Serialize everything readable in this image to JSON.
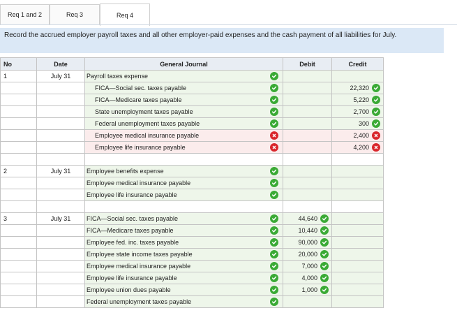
{
  "tabs": [
    {
      "label": "Req 1 and 2"
    },
    {
      "label": "Req 3"
    },
    {
      "label": "Req 4"
    }
  ],
  "instructions": "Record the accrued employer payroll taxes and all other employer-paid expenses and the cash payment of all liabilities for July.",
  "table": {
    "headers": {
      "no": "No",
      "date": "Date",
      "account": "General Journal",
      "debit": "Debit",
      "credit": "Credit"
    },
    "rows": [
      {
        "no": "1",
        "date": "July 31",
        "account": "Payroll taxes expense",
        "indent": false,
        "debit": "",
        "credit": "",
        "status": "ok",
        "debit_status": "",
        "credit_status": ""
      },
      {
        "no": "",
        "date": "",
        "account": "FICA—Social sec. taxes payable",
        "indent": true,
        "debit": "",
        "credit": "22,320",
        "status": "ok",
        "debit_status": "",
        "credit_status": "ok"
      },
      {
        "no": "",
        "date": "",
        "account": "FICA—Medicare taxes payable",
        "indent": true,
        "debit": "",
        "credit": "5,220",
        "status": "ok",
        "debit_status": "",
        "credit_status": "ok"
      },
      {
        "no": "",
        "date": "",
        "account": "State unemployment taxes payable",
        "indent": true,
        "debit": "",
        "credit": "2,700",
        "status": "ok",
        "debit_status": "",
        "credit_status": "ok"
      },
      {
        "no": "",
        "date": "",
        "account": "Federal unemployment taxes payable",
        "indent": true,
        "debit": "",
        "credit": "300",
        "status": "ok",
        "debit_status": "",
        "credit_status": "ok"
      },
      {
        "no": "",
        "date": "",
        "account": "Employee medical insurance payable",
        "indent": true,
        "debit": "",
        "credit": "2,400",
        "status": "bad",
        "debit_status": "",
        "credit_status": "bad"
      },
      {
        "no": "",
        "date": "",
        "account": "Employee life insurance payable",
        "indent": true,
        "debit": "",
        "credit": "4,200",
        "status": "bad",
        "debit_status": "",
        "credit_status": "bad"
      },
      {
        "no": "",
        "date": "",
        "account": "",
        "indent": false,
        "debit": "",
        "credit": "",
        "status": "",
        "debit_status": "",
        "credit_status": ""
      },
      {
        "no": "2",
        "date": "July 31",
        "account": "Employee benefits expense",
        "indent": false,
        "debit": "",
        "credit": "",
        "status": "ok",
        "debit_status": "",
        "credit_status": ""
      },
      {
        "no": "",
        "date": "",
        "account": "Employee medical insurance payable",
        "indent": false,
        "debit": "",
        "credit": "",
        "status": "ok",
        "debit_status": "",
        "credit_status": ""
      },
      {
        "no": "",
        "date": "",
        "account": "Employee life insurance payable",
        "indent": false,
        "debit": "",
        "credit": "",
        "status": "ok",
        "debit_status": "",
        "credit_status": ""
      },
      {
        "no": "",
        "date": "",
        "account": "",
        "indent": false,
        "debit": "",
        "credit": "",
        "status": "",
        "debit_status": "",
        "credit_status": ""
      },
      {
        "no": "3",
        "date": "July 31",
        "account": "FICA—Social sec. taxes payable",
        "indent": false,
        "debit": "44,640",
        "credit": "",
        "status": "ok",
        "debit_status": "ok",
        "credit_status": ""
      },
      {
        "no": "",
        "date": "",
        "account": "FICA—Medicare taxes payable",
        "indent": false,
        "debit": "10,440",
        "credit": "",
        "status": "ok",
        "debit_status": "ok",
        "credit_status": ""
      },
      {
        "no": "",
        "date": "",
        "account": "Employee fed. inc. taxes payable",
        "indent": false,
        "debit": "90,000",
        "credit": "",
        "status": "ok",
        "debit_status": "ok",
        "credit_status": ""
      },
      {
        "no": "",
        "date": "",
        "account": "Employee state income taxes payable",
        "indent": false,
        "debit": "20,000",
        "credit": "",
        "status": "ok",
        "debit_status": "ok",
        "credit_status": ""
      },
      {
        "no": "",
        "date": "",
        "account": "Employee medical insurance payable",
        "indent": false,
        "debit": "7,000",
        "credit": "",
        "status": "ok",
        "debit_status": "ok",
        "credit_status": ""
      },
      {
        "no": "",
        "date": "",
        "account": "Employee life insurance payable",
        "indent": false,
        "debit": "4,000",
        "credit": "",
        "status": "ok",
        "debit_status": "ok",
        "credit_status": ""
      },
      {
        "no": "",
        "date": "",
        "account": "Employee union dues payable",
        "indent": false,
        "debit": "1,000",
        "credit": "",
        "status": "ok",
        "debit_status": "ok",
        "credit_status": ""
      },
      {
        "no": "",
        "date": "",
        "account": "Federal unemployment taxes payable",
        "indent": false,
        "debit": "",
        "credit": "",
        "status": "ok",
        "debit_status": "",
        "credit_status": ""
      }
    ]
  },
  "colors": {
    "ok": "#3aaa35",
    "bad": "#d9262c",
    "header_bg": "#e8edf3",
    "instr_bg": "#dbe8f6"
  }
}
